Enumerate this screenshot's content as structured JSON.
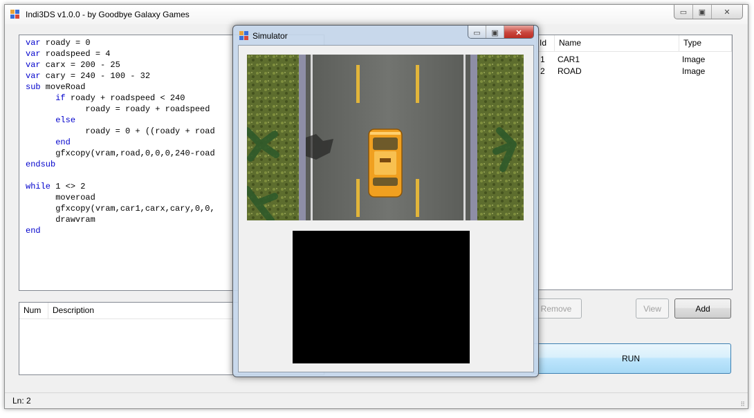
{
  "main_window": {
    "title": "Indi3DS v1.0.0 - by Goodbye Galaxy Games",
    "minimize_glyph": "▭",
    "maximize_glyph": "▣",
    "close_glyph": "✕"
  },
  "editor": {
    "lines": [
      {
        "kw": "var",
        "text": " roady = 0"
      },
      {
        "kw": "var",
        "text": " roadspeed = 4"
      },
      {
        "kw": "var",
        "text": " carx = 200 - 25"
      },
      {
        "kw": "var",
        "text": " cary = 240 - 100 - 32"
      },
      {
        "kw": "sub",
        "text": " moveRoad"
      },
      {
        "indent": "      ",
        "kw": "if",
        "text": " roady + roadspeed < 240"
      },
      {
        "indent": "            ",
        "kw": "",
        "text": "roady = roady + roadspeed"
      },
      {
        "indent": "      ",
        "kw": "else",
        "text": ""
      },
      {
        "indent": "            ",
        "kw": "",
        "text": "roady = 0 + ((roady + road"
      },
      {
        "indent": "      ",
        "kw": "end",
        "text": ""
      },
      {
        "indent": "      ",
        "kw": "",
        "text": "gfxcopy(vram,road,0,0,0,240-road"
      },
      {
        "kw": "endsub",
        "text": ""
      },
      {
        "kw": "",
        "text": ""
      },
      {
        "kw": "while",
        "text": " 1 <> 2"
      },
      {
        "indent": "      ",
        "kw": "",
        "text": "moveroad"
      },
      {
        "indent": "      ",
        "kw": "",
        "text": "gfxcopy(vram,car1,carx,cary,0,0,"
      },
      {
        "indent": "      ",
        "kw": "",
        "text": "drawvram"
      },
      {
        "kw": "end",
        "text": ""
      }
    ]
  },
  "errors": {
    "columns": [
      "Num",
      "Description"
    ]
  },
  "resources": {
    "columns": [
      "Id",
      "Name",
      "Type"
    ],
    "rows": [
      {
        "id": "1",
        "name": "CAR1",
        "type": "Image"
      },
      {
        "id": "2",
        "name": "ROAD",
        "type": "Image"
      }
    ]
  },
  "buttons": {
    "remove": "Remove",
    "view": "View",
    "add": "Add",
    "run": "RUN"
  },
  "status": {
    "text": "Ln: 2"
  },
  "simulator": {
    "title": "Simulator",
    "minimize_glyph": "▭",
    "maximize_glyph": "▣",
    "close_glyph": "✕"
  },
  "colors": {
    "keyword": "#0000cc",
    "close_button": "#c9463d",
    "car": "#f0a020"
  }
}
